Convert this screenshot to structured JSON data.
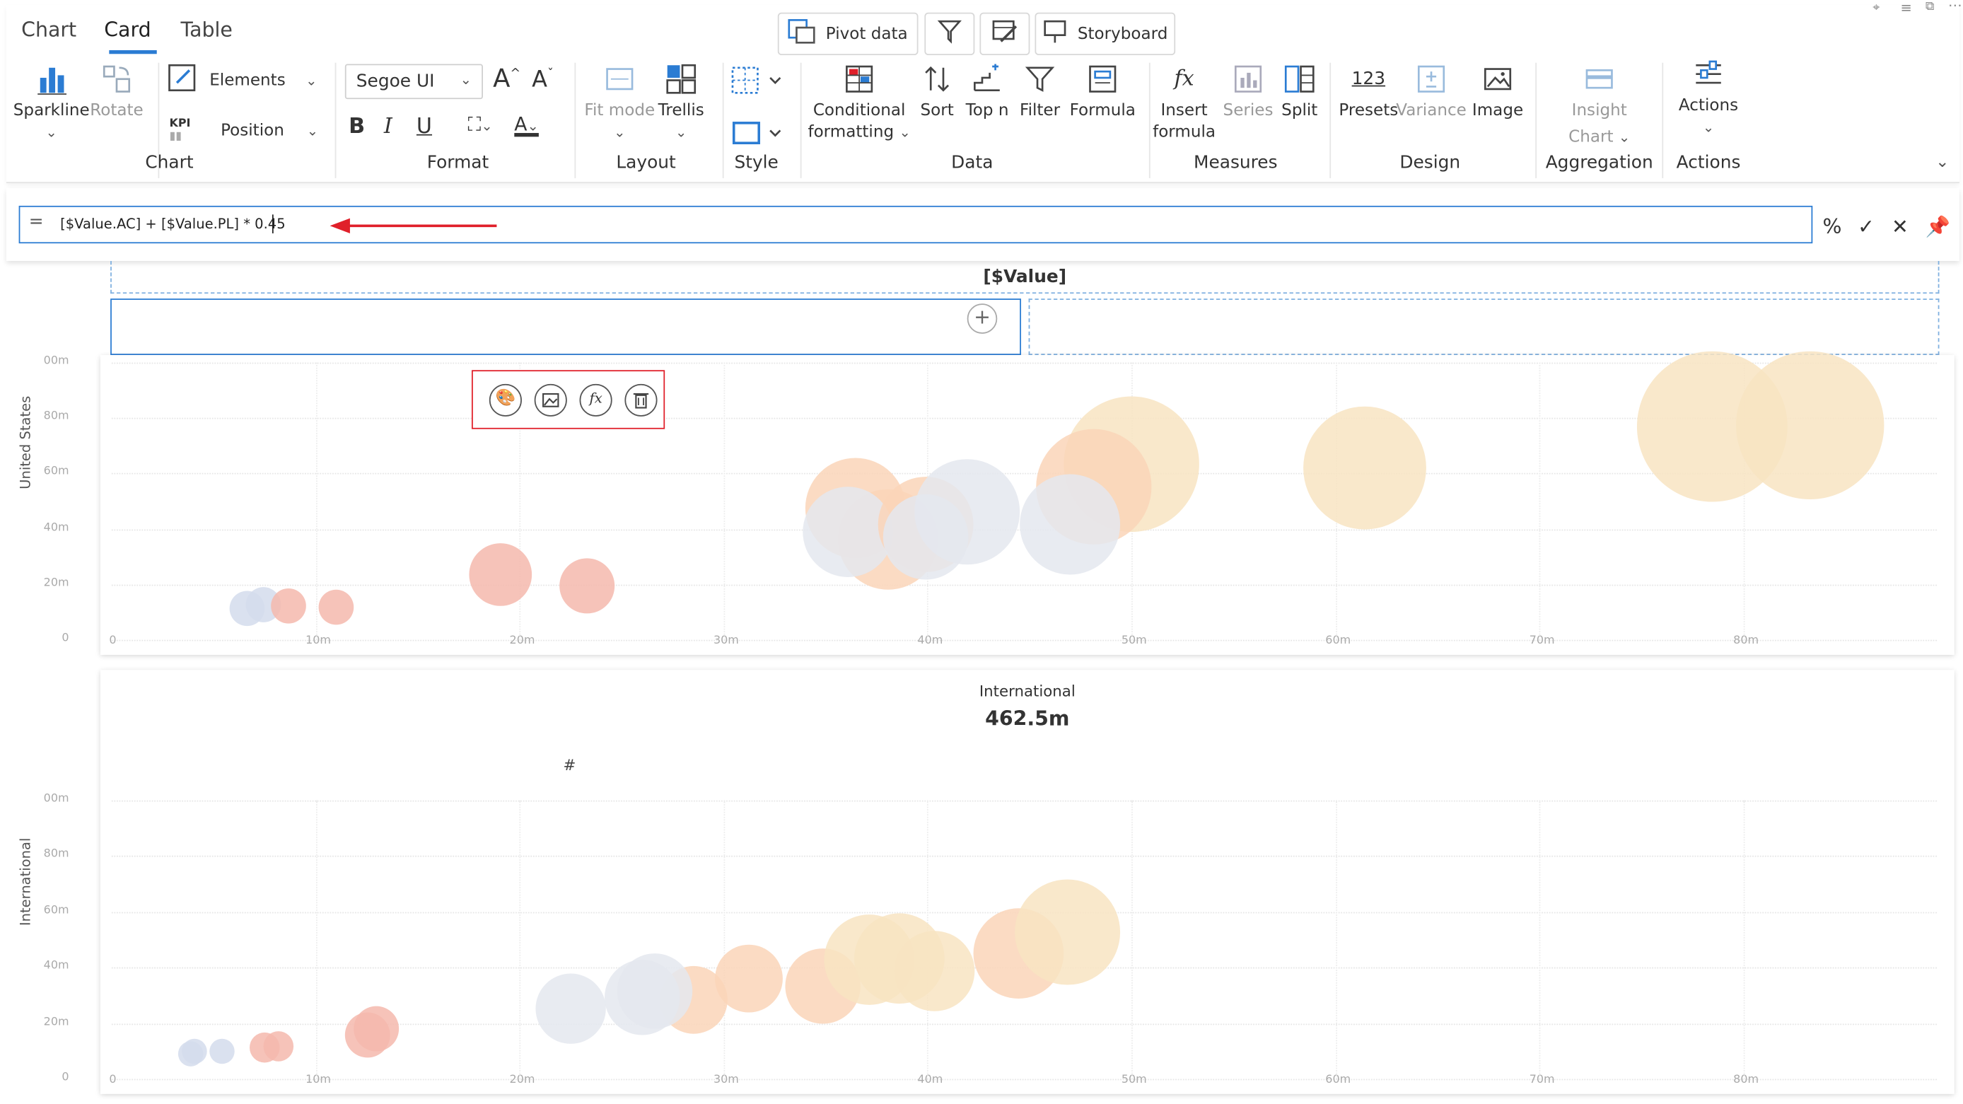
{
  "tabs": [
    {
      "label": "Chart",
      "active": false
    },
    {
      "label": "Card",
      "active": true
    },
    {
      "label": "Table",
      "active": false
    }
  ],
  "top_buttons": {
    "pivot": "Pivot data",
    "storyboard": "Storyboard"
  },
  "ribbon": {
    "sparkline": "Sparkline",
    "rotate": "Rotate",
    "elements": "Elements",
    "kpi": "KPI",
    "position": "Position",
    "font": "Segoe UI",
    "fit_mode": "Fit mode",
    "trellis": "Trellis",
    "conditional": "Conditional",
    "formatting": "formatting",
    "sort": "Sort",
    "topn": "Top n",
    "filter": "Filter",
    "formula": "Formula",
    "insert": "Insert",
    "formula2": "formula",
    "series": "Series",
    "split": "Split",
    "presets_icon": "123",
    "presets": "Presets",
    "variance": "Variance",
    "image": "Image",
    "insight": "Insight",
    "insight_chart": "Chart",
    "actions": "Actions",
    "groups": {
      "chart": "Chart",
      "format": "Format",
      "layout": "Layout",
      "style": "Style",
      "data": "Data",
      "measures": "Measures",
      "design": "Design",
      "aggregation": "Aggregation",
      "actions": "Actions"
    }
  },
  "formula_bar": {
    "expression": "[$Value.AC] + [$Value.PL] * 0.45",
    "percent": "%",
    "accept": "✓",
    "cancel": "✕"
  },
  "card": {
    "title": "[$Value]"
  },
  "panels": [
    {
      "row_label": "United States",
      "y_ticks": [
        "00m",
        "80m",
        "60m",
        "40m",
        "20m",
        "0"
      ],
      "x_ticks": [
        "0",
        "10m",
        "20m",
        "30m",
        "40m",
        "50m",
        "60m",
        "70m",
        "80m"
      ]
    },
    {
      "row_label": "International",
      "title": "International",
      "value": "462.5m",
      "hash": "#",
      "y_ticks": [
        "00m",
        "80m",
        "60m",
        "40m",
        "20m",
        "0"
      ],
      "x_ticks": [
        "0",
        "10m",
        "20m",
        "30m",
        "40m",
        "50m",
        "60m",
        "70m",
        "80m"
      ]
    }
  ],
  "colors": {
    "accent": "#2b7cd3",
    "highlight": "#e0202a",
    "bubble_red": "#f4b9ad",
    "bubble_orange": "#fad5b8",
    "bubble_cream": "#f8e4c2",
    "bubble_grey": "#e4e7ee",
    "bubble_blue": "#d3dcec"
  }
}
